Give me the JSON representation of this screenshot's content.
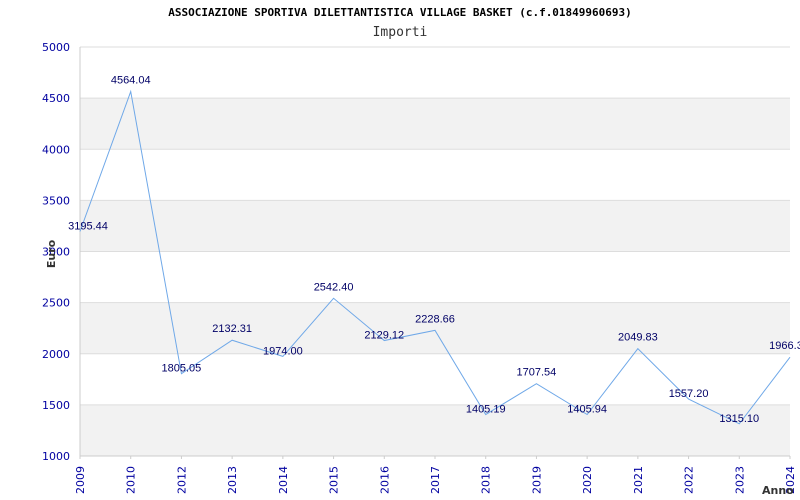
{
  "chart_data": {
    "type": "line",
    "title": "ASSOCIAZIONE SPORTIVA DILETTANTISTICA VILLAGE BASKET (c.f.01849960693)",
    "subtitle": "Importi",
    "xlabel": "Anno",
    "ylabel": "Euro",
    "x": [
      "2009",
      "2010",
      "2012",
      "2013",
      "2014",
      "2015",
      "2016",
      "2017",
      "2018",
      "2019",
      "2020",
      "2021",
      "2022",
      "2023",
      "2024"
    ],
    "values": [
      3195.44,
      4564.04,
      1805.05,
      2132.31,
      1974.0,
      2542.4,
      2129.12,
      2228.66,
      1405.19,
      1707.54,
      1405.94,
      2049.83,
      1557.2,
      1315.1,
      1966.3
    ],
    "labels": [
      "3195.44",
      "4564.04",
      "1805.05",
      "2132.31",
      "1974.00",
      "2542.40",
      "2129.12",
      "2228.66",
      "1405.19",
      "1707.54",
      "1405.94",
      "2049.83",
      "1557.20",
      "1315.10",
      "1966.3"
    ],
    "yticks": [
      1000,
      1500,
      2000,
      2500,
      3000,
      3500,
      4000,
      4500,
      5000
    ],
    "ylim": [
      1000,
      5000
    ],
    "grid": true,
    "line_color": "#6fa8e8",
    "band_color": "#f2f2f2",
    "tick_color": "#0000a0"
  }
}
